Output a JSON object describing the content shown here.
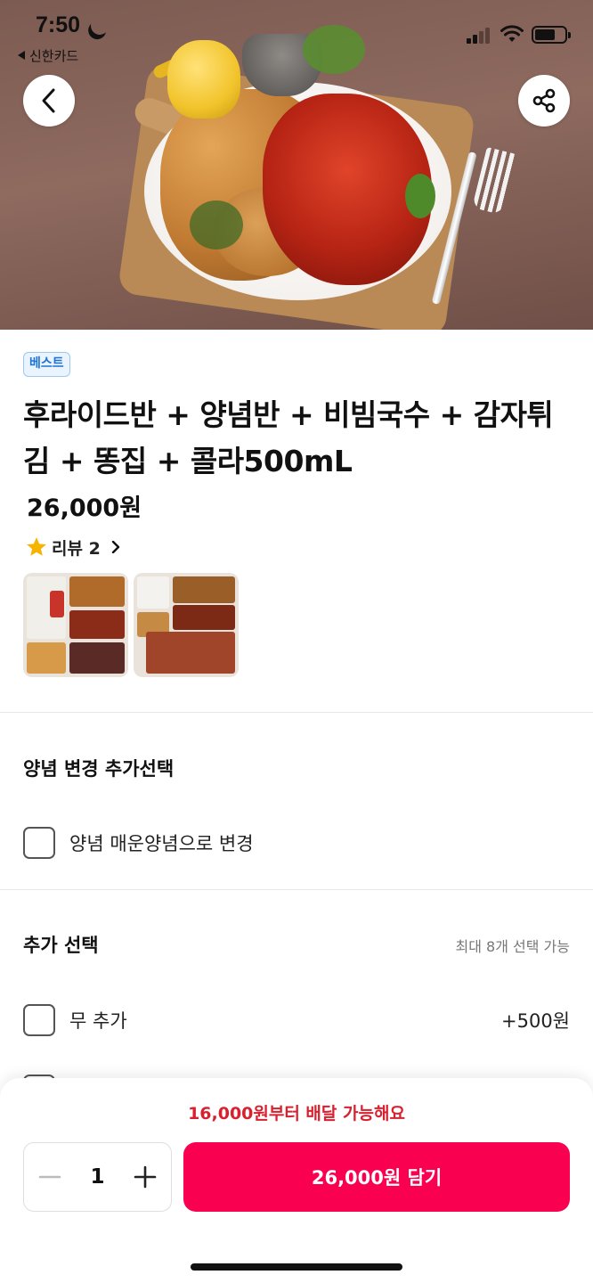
{
  "status_bar": {
    "time": "7:50",
    "back_app_label": "신한카드"
  },
  "menu": {
    "badge": "베스트",
    "title": "후라이드반 + 양념반 + 비빔국수 + 감자튀김 + 똥집 + 콜라500mL",
    "price": "26,000원",
    "review_label": "리뷰 2"
  },
  "sections": {
    "sauce": {
      "title": "양념 변경 추가선택",
      "options": [
        {
          "label": "양념 매운양념으로 변경"
        }
      ]
    },
    "extras": {
      "title": "추가 선택",
      "hint": "최대 8개 선택 가능",
      "options": [
        {
          "label": "무 추가",
          "price": "+500원"
        }
      ]
    }
  },
  "bottom": {
    "min_order_notice": "16,000원부터 배달 가능해요",
    "quantity": "1",
    "add_button_label": "26,000원 담기"
  },
  "colors": {
    "accent": "#fa0050",
    "notice_red": "#d8202f",
    "badge_blue": "#1f73d2",
    "star": "#f5b400"
  },
  "icons": [
    "back-icon",
    "share-icon",
    "star-icon",
    "chevron-right-icon",
    "minus-icon",
    "plus-icon",
    "checkbox-icon"
  ]
}
